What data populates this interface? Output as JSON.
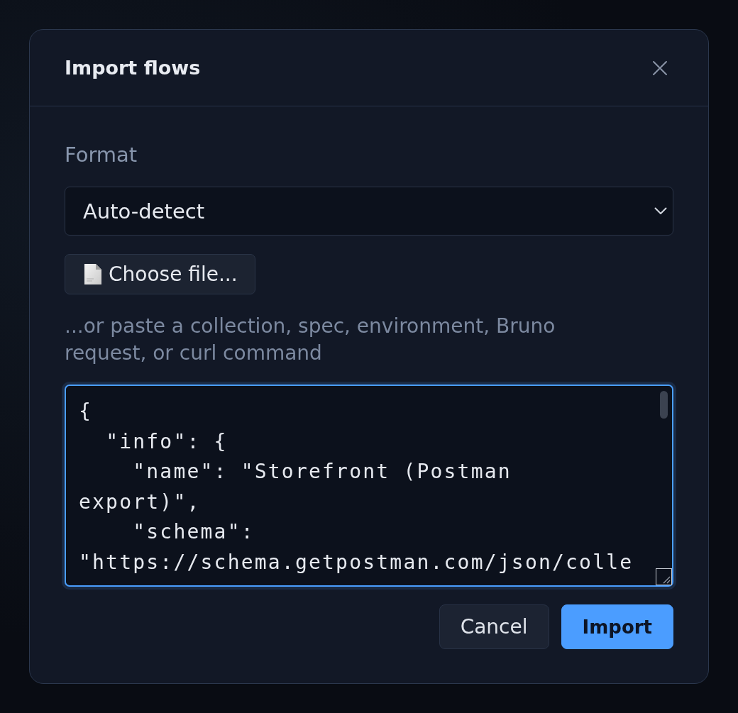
{
  "dialog": {
    "title": "Import flows"
  },
  "format": {
    "label": "Format",
    "value": "Auto-detect"
  },
  "file_button": {
    "label": "Choose file..."
  },
  "paste_hint": "...or paste a collection, spec, environment, Bruno request, or curl command",
  "paste_field": {
    "value": "{\n  \"info\": {\n    \"name\": \"Storefront (Postman export)\",\n    \"schema\": \"https://schema.getpostman.com/json/colle",
    "focused": true
  },
  "buttons": [
    {
      "label": "Cancel",
      "kind": "secondary"
    },
    {
      "label": "Import",
      "kind": "primary"
    }
  ]
}
